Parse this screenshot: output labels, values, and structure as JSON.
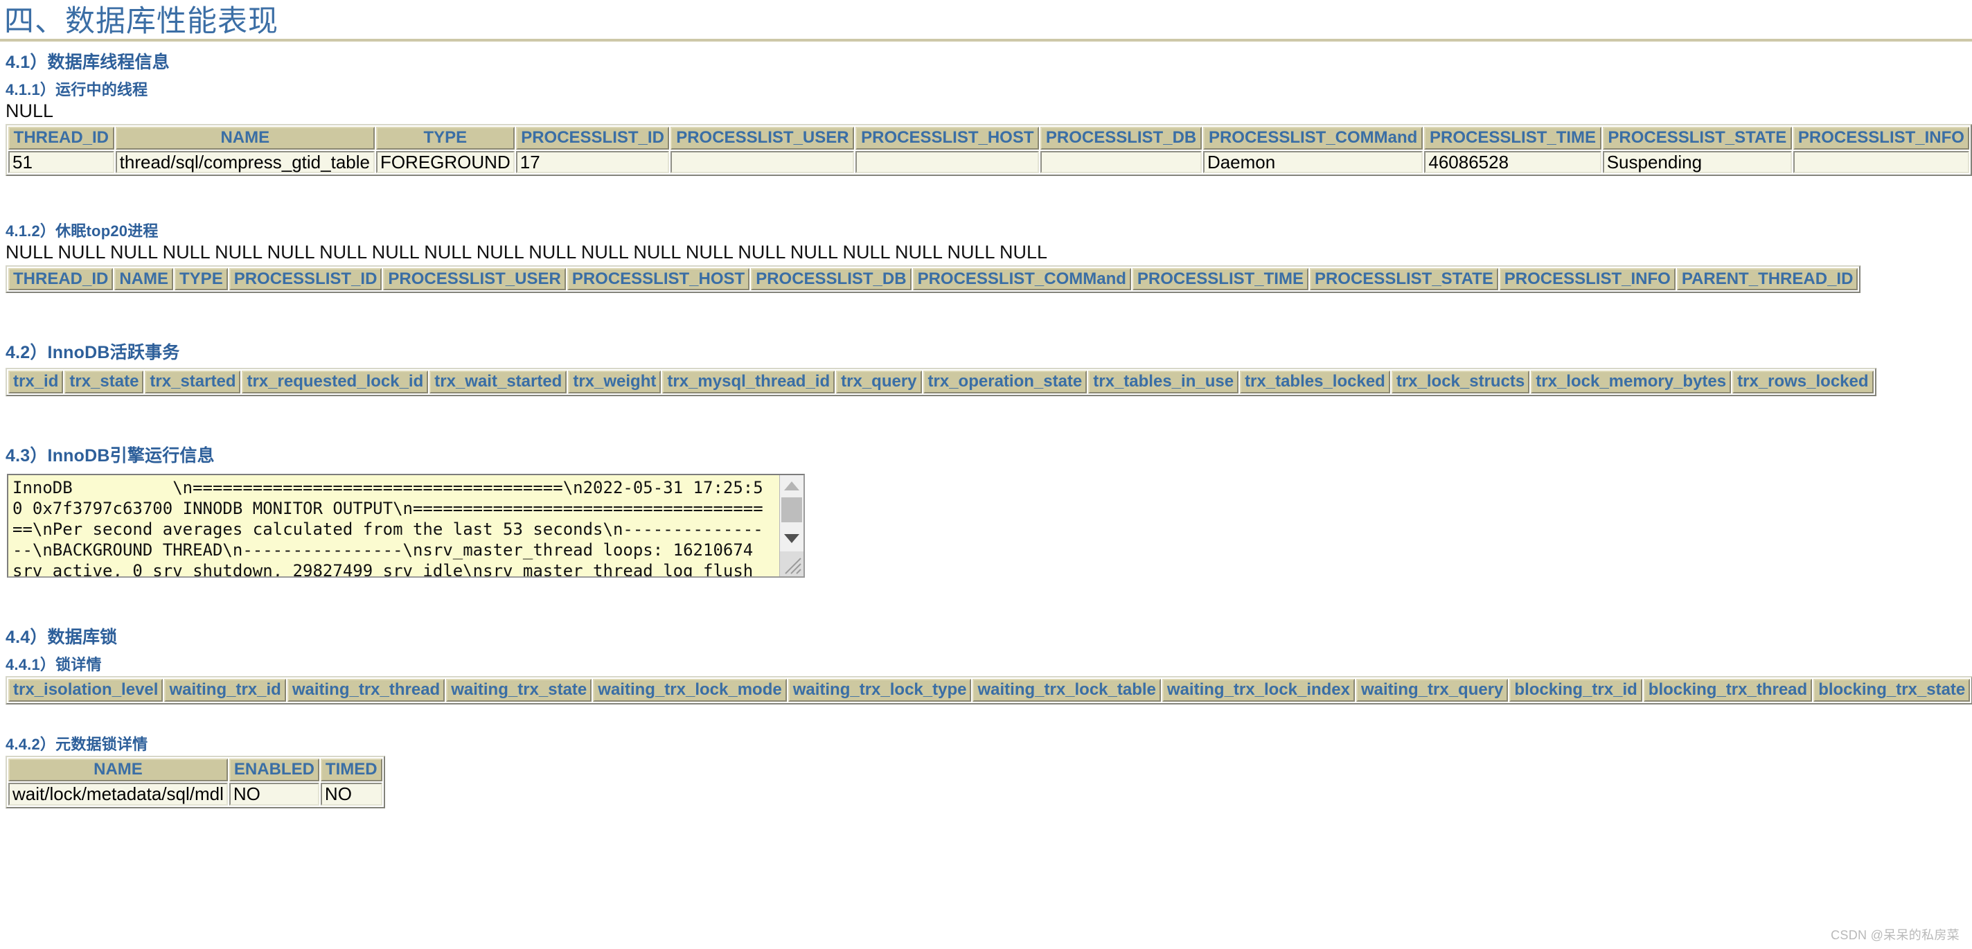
{
  "document": {
    "title": "四、数据库性能表现",
    "accent_color": "#2d5f9a",
    "rule_color": "#cdc8a8",
    "table_header_bg": "#cdc8a0",
    "table_cell_bg": "#f6f6e7",
    "textarea_bg": "#fbfbd0"
  },
  "sections": {
    "s41": {
      "heading": "4.1）数据库线程信息",
      "s411": {
        "heading": "4.1.1）运行中的线程",
        "note": "NULL",
        "table": {
          "headers": [
            "THREAD_ID",
            "NAME",
            "TYPE",
            "PROCESSLIST_ID",
            "PROCESSLIST_USER",
            "PROCESSLIST_HOST",
            "PROCESSLIST_DB",
            "PROCESSLIST_COMMand",
            "PROCESSLIST_TIME",
            "PROCESSLIST_STATE",
            "PROCESSLIST_INFO"
          ],
          "rows": [
            [
              "51",
              "thread/sql/compress_gtid_table",
              "FOREGROUND",
              "17",
              "",
              "",
              "",
              "Daemon",
              "46086528",
              "Suspending",
              ""
            ]
          ]
        }
      },
      "s412": {
        "heading": "4.1.2）休眠top20进程",
        "note": "NULL NULL NULL NULL NULL NULL NULL NULL NULL NULL NULL NULL NULL NULL NULL NULL NULL NULL NULL NULL",
        "table": {
          "headers": [
            "THREAD_ID",
            "NAME",
            "TYPE",
            "PROCESSLIST_ID",
            "PROCESSLIST_USER",
            "PROCESSLIST_HOST",
            "PROCESSLIST_DB",
            "PROCESSLIST_COMMand",
            "PROCESSLIST_TIME",
            "PROCESSLIST_STATE",
            "PROCESSLIST_INFO",
            "PARENT_THREAD_ID"
          ],
          "rows": []
        }
      }
    },
    "s42": {
      "heading": "4.2）InnoDB活跃事务",
      "table": {
        "headers": [
          "trx_id",
          "trx_state",
          "trx_started",
          "trx_requested_lock_id",
          "trx_wait_started",
          "trx_weight",
          "trx_mysql_thread_id",
          "trx_query",
          "trx_operation_state",
          "trx_tables_in_use",
          "trx_tables_locked",
          "trx_lock_structs",
          "trx_lock_memory_bytes",
          "trx_rows_locked"
        ],
        "rows": []
      }
    },
    "s43": {
      "heading": "4.3）InnoDB引擎运行信息",
      "textarea_value": "InnoDB          \\n=====================================\\n2022-05-31 17:25:50 0x7f3797c63700 INNODB MONITOR OUTPUT\\n=====================================\\nPer second averages calculated from the last 53 seconds\\n----------------\\nBACKGROUND THREAD\\n----------------\\nsrv_master_thread loops: 16210674 srv_active, 0 srv_shutdown, 29827499 srv_idle\\nsrv_master_thread log flush and writes:"
    },
    "s44": {
      "heading": "4.4）数据库锁",
      "s441": {
        "heading": "4.4.1）锁详情",
        "table": {
          "headers": [
            "trx_isolation_level",
            "waiting_trx_id",
            "waiting_trx_thread",
            "waiting_trx_state",
            "waiting_trx_lock_mode",
            "waiting_trx_lock_type",
            "waiting_trx_lock_table",
            "waiting_trx_lock_index",
            "waiting_trx_query",
            "blocking_trx_id",
            "blocking_trx_thread",
            "blocking_trx_state"
          ],
          "rows": []
        }
      },
      "s442": {
        "heading": "4.4.2）元数据锁详情",
        "table": {
          "headers": [
            "NAME",
            "ENABLED",
            "TIMED"
          ],
          "rows": [
            [
              "wait/lock/metadata/sql/mdl",
              "NO",
              "NO"
            ]
          ]
        }
      }
    }
  },
  "watermark": "CSDN @呆呆的私房菜"
}
